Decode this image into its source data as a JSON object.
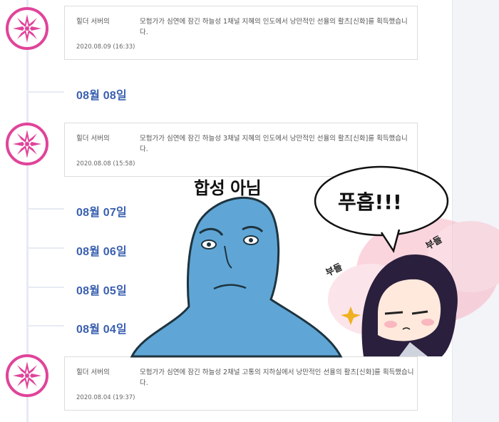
{
  "timeline": {
    "events": [
      {
        "server": "힐더 서버의",
        "message": "모험가가 심연에 잠긴 하늘성 1채널 지혜의 인도에서 낭만적인 선율의 활츠[신화]를 획득했습니다.",
        "time": "2020.08.09 (16:33)"
      },
      {
        "server": "힐더 서버의",
        "message": "모험가가 심연에 잠긴 하늘성 3채널 지혜의 인도에서 낭만적인 선율의 활츠[신화]를 획득했습니다.",
        "time": "2020.08.08 (15:58)"
      },
      {
        "server": "힐더 서버의",
        "message": "모험가가 심연에 잠긴 하늘성 2채널 고통의 지하실에서 낭만적인 선율의 활츠[신화]를 획득했습니다.",
        "time": "2020.08.04 (19:37)"
      }
    ],
    "dates": [
      "08월 08일",
      "08월 07일",
      "08월 06일",
      "08월 05일",
      "08월 04일"
    ],
    "badge_icon": "sparkle-burst-icon",
    "accent_color": "#e0449a",
    "date_color": "#3a5fb0"
  },
  "meme": {
    "caption": "합성 아님",
    "speech": "푸흡!!!",
    "sfx_left": "부들",
    "sfx_right": "부들"
  }
}
